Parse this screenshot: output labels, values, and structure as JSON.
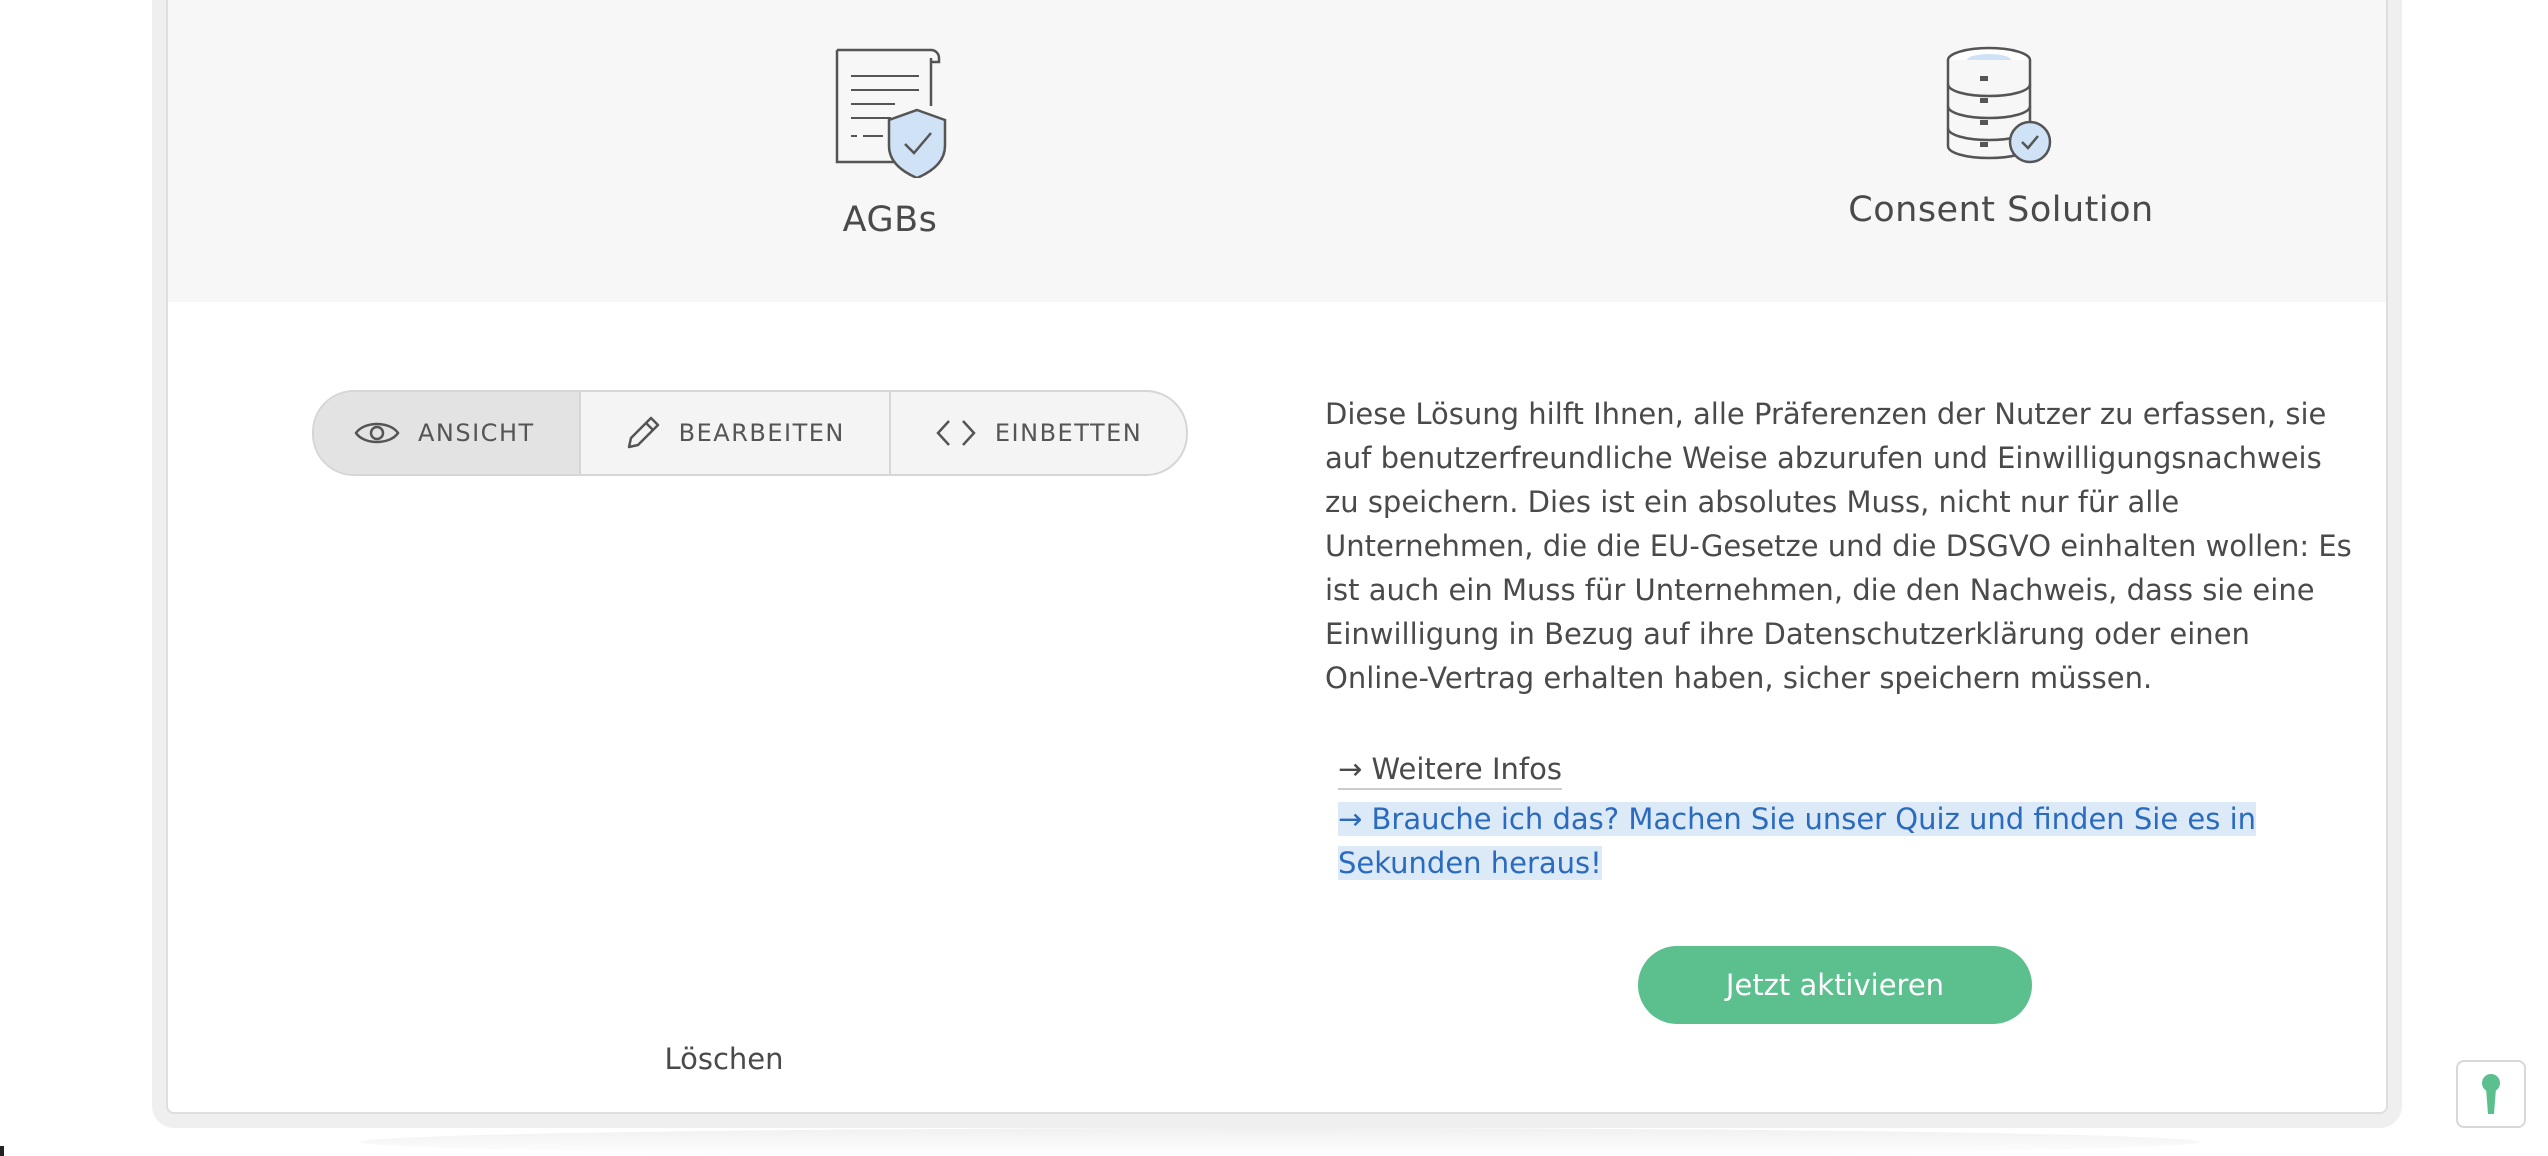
{
  "products": [
    {
      "title": "AGBs",
      "icon": "document-shield-icon"
    },
    {
      "title": "Consent Solution",
      "icon": "database-check-icon"
    }
  ],
  "tabs": [
    {
      "label": "ANSICHT",
      "icon": "eye-icon",
      "active": true
    },
    {
      "label": "BEARBEITEN",
      "icon": "pencil-icon",
      "active": false
    },
    {
      "label": "EINBETTEN",
      "icon": "code-icon",
      "active": false
    }
  ],
  "description": "Diese Lösung hilft Ihnen, alle Präferenzen der Nutzer zu erfassen, sie auf benutzerfreundliche Weise abzurufen und Einwilligungsnachweis zu speichern. Dies ist ein absolutes Muss, nicht nur für alle Unternehmen, die die EU-Gesetze und die DSGVO einhalten wollen: Es ist auch ein Muss für Unternehmen, die den Nachweis, dass sie eine Einwilligung in Bezug auf ihre Datenschutzerklärung oder einen Online-Vertrag erhalten haben, sicher speichern müssen.",
  "links": {
    "more_info": "→ Weitere Infos",
    "quiz": "→ Brauche ich das? Machen Sie unser Quiz und finden Sie es in Sekunden heraus!"
  },
  "activate_label": "Jetzt aktivieren",
  "delete_label": "Löschen",
  "colors": {
    "accent_green": "#5bbf8e",
    "link_blue": "#2a6bbf",
    "icon_blue": "#cfe2f6"
  }
}
